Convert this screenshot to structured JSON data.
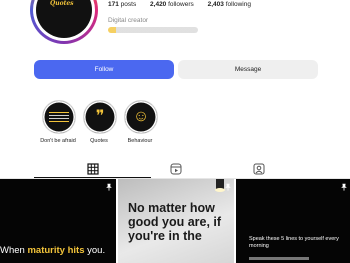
{
  "profile": {
    "avatar_text": "Quotes",
    "stats": [
      {
        "value": "171",
        "label": "posts"
      },
      {
        "value": "2,420",
        "label": "followers"
      },
      {
        "value": "2,403",
        "label": "following"
      }
    ],
    "category": "Digital creator"
  },
  "buttons": {
    "follow": "Follow",
    "message": "Message"
  },
  "highlights": [
    {
      "label": "Don't be afraid",
      "icon": "text-lines-icon"
    },
    {
      "label": "Quotes",
      "icon": "quote-marks-icon",
      "glyph": "❞"
    },
    {
      "label": "Behaviour",
      "icon": "smiley-icon",
      "glyph": "☺"
    }
  ],
  "tabs": [
    {
      "name": "posts",
      "icon": "grid-icon"
    },
    {
      "name": "reels",
      "icon": "reels-icon"
    },
    {
      "name": "tagged",
      "icon": "tagged-icon"
    }
  ],
  "posts": {
    "post1": {
      "text_before": "When ",
      "highlight": "maturity hits",
      "text_after": " you."
    },
    "post2": {
      "text": "No matter how good you are, if you're in the"
    },
    "post3": {
      "text": "Speak these 5 lines to yourself every morning"
    }
  },
  "colors": {
    "accent_blue": "#4b68f0",
    "gold": "#f3c43a",
    "button_grey": "#efefef"
  }
}
